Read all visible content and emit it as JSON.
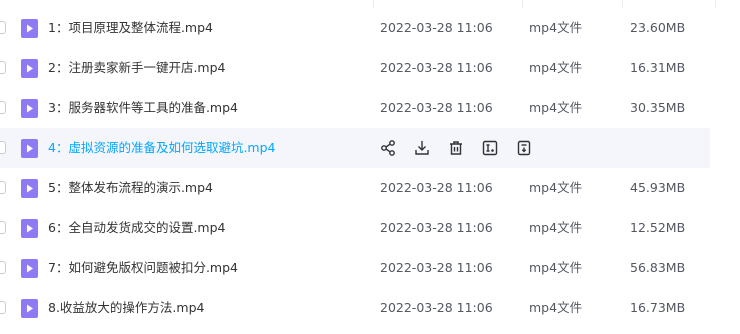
{
  "files": [
    {
      "name": "1：项目原理及整体流程.mp4",
      "date": "2022-03-28 11:06",
      "type": "mp4文件",
      "size": "23.60MB"
    },
    {
      "name": "2：注册卖家新手一键开店.mp4",
      "date": "2022-03-28 11:06",
      "type": "mp4文件",
      "size": "16.31MB"
    },
    {
      "name": "3：服务器软件等工具的准备.mp4",
      "date": "2022-03-28 11:06",
      "type": "mp4文件",
      "size": "30.35MB"
    },
    {
      "name": "4：虚拟资源的准备及如何选取避坑.mp4",
      "hovered": true
    },
    {
      "name": "5：整体发布流程的演示.mp4",
      "date": "2022-03-28 11:06",
      "type": "mp4文件",
      "size": "45.93MB"
    },
    {
      "name": "6：全自动发货成交的设置.mp4",
      "date": "2022-03-28 11:06",
      "type": "mp4文件",
      "size": "12.52MB"
    },
    {
      "name": "7：如何避免版权问题被扣分.mp4",
      "date": "2022-03-28 11:06",
      "type": "mp4文件",
      "size": "56.83MB"
    },
    {
      "name": "8.收益放大的操作方法.mp4",
      "date": "2022-03-28 11:06",
      "type": "mp4文件",
      "size": "16.73MB"
    }
  ],
  "hover_actions": [
    "share-icon",
    "download-icon",
    "delete-icon",
    "rename-icon",
    "move-icon"
  ],
  "colors": {
    "accent": "#06a7ff",
    "icon_fill": "#8f7af5",
    "text_primary": "#333336",
    "text_secondary": "#545761",
    "hover_bg": "#f4f6fb"
  }
}
